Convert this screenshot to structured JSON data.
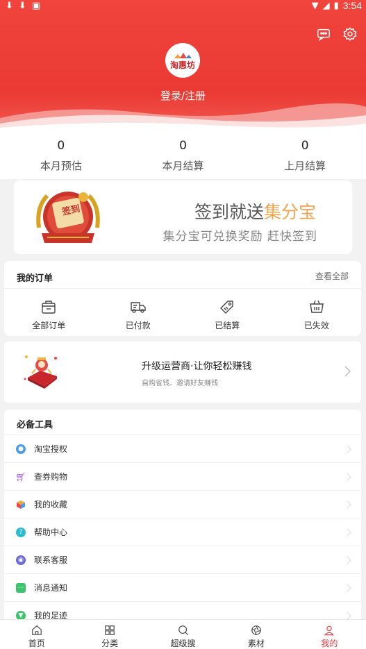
{
  "status": {
    "time": "3:54"
  },
  "header": {
    "logo_text": "淘惠坊",
    "login": "登录/注册"
  },
  "stats": [
    {
      "value": "0",
      "label": "本月预估"
    },
    {
      "value": "0",
      "label": "本月结算"
    },
    {
      "value": "0",
      "label": "上月结算"
    }
  ],
  "signin": {
    "badge_text": "签到",
    "title_prefix": "签到就送",
    "title_highlight": "集分宝",
    "subtitle": "集分宝可兑换奖励  赶快签到"
  },
  "orders": {
    "title": "我的订单",
    "more": "查看全部",
    "items": [
      {
        "label": "全部订单",
        "icon": "bag-icon"
      },
      {
        "label": "已付款",
        "icon": "truck-icon"
      },
      {
        "label": "已结算",
        "icon": "tag-icon"
      },
      {
        "label": "已失效",
        "icon": "basket-icon"
      }
    ]
  },
  "upgrade": {
    "title": "升级运营商·让你轻松赚钱",
    "subtitle": "自购省钱、邀请好友赚钱"
  },
  "tools": {
    "title": "必备工具",
    "items": [
      {
        "label": "淘宝授权",
        "icon": "lock-icon",
        "color": "#4a9ee8"
      },
      {
        "label": "查券购物",
        "icon": "cart-icon",
        "color": "#9a4ad8"
      },
      {
        "label": "我的收藏",
        "icon": "cube-icon",
        "color": "#f2a93b"
      },
      {
        "label": "帮助中心",
        "icon": "help-icon",
        "color": "#2bbbd0"
      },
      {
        "label": "联系客服",
        "icon": "service-icon",
        "color": "#6a6ad8"
      },
      {
        "label": "消息通知",
        "icon": "message-icon",
        "color": "#3cc36d"
      },
      {
        "label": "我的足迹",
        "icon": "footprint-icon",
        "color": "#3cc36d"
      }
    ]
  },
  "tabs": [
    {
      "label": "首页",
      "icon": "home-icon"
    },
    {
      "label": "分类",
      "icon": "category-icon"
    },
    {
      "label": "超级搜",
      "icon": "search-icon"
    },
    {
      "label": "素材",
      "icon": "aperture-icon"
    },
    {
      "label": "我的",
      "icon": "user-icon",
      "active": true
    }
  ]
}
